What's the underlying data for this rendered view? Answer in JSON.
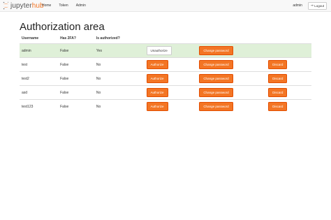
{
  "nav": {
    "logo_main": "jupyter",
    "logo_accent": "hub",
    "links": [
      "Home",
      "Token",
      "Admin"
    ],
    "user": "admin",
    "logout_label": "Logout"
  },
  "page_title": "Authorization area",
  "table": {
    "headers": [
      "Username",
      "Has 2FA?",
      "Is authorized?"
    ],
    "rows": [
      {
        "username": "admin",
        "has2fa": "False",
        "authorized": "Yes",
        "auth_button": "Unauthorize",
        "change_button": "Change password",
        "discard_button": ""
      },
      {
        "username": "test",
        "has2fa": "False",
        "authorized": "No",
        "auth_button": "Authorize",
        "change_button": "Change password",
        "discard_button": "Discard"
      },
      {
        "username": "test2",
        "has2fa": "False",
        "authorized": "No",
        "auth_button": "Authorize",
        "change_button": "Change password",
        "discard_button": "Discard"
      },
      {
        "username": "asd",
        "has2fa": "False",
        "authorized": "No",
        "auth_button": "Authorize",
        "change_button": "Change password",
        "discard_button": "Discard"
      },
      {
        "username": "test123",
        "has2fa": "False",
        "authorized": "No",
        "auth_button": "Authorize",
        "change_button": "Change password",
        "discard_button": "Discard"
      }
    ]
  },
  "colors": {
    "accent": "#f37524",
    "success_row": "#dff0d8"
  }
}
